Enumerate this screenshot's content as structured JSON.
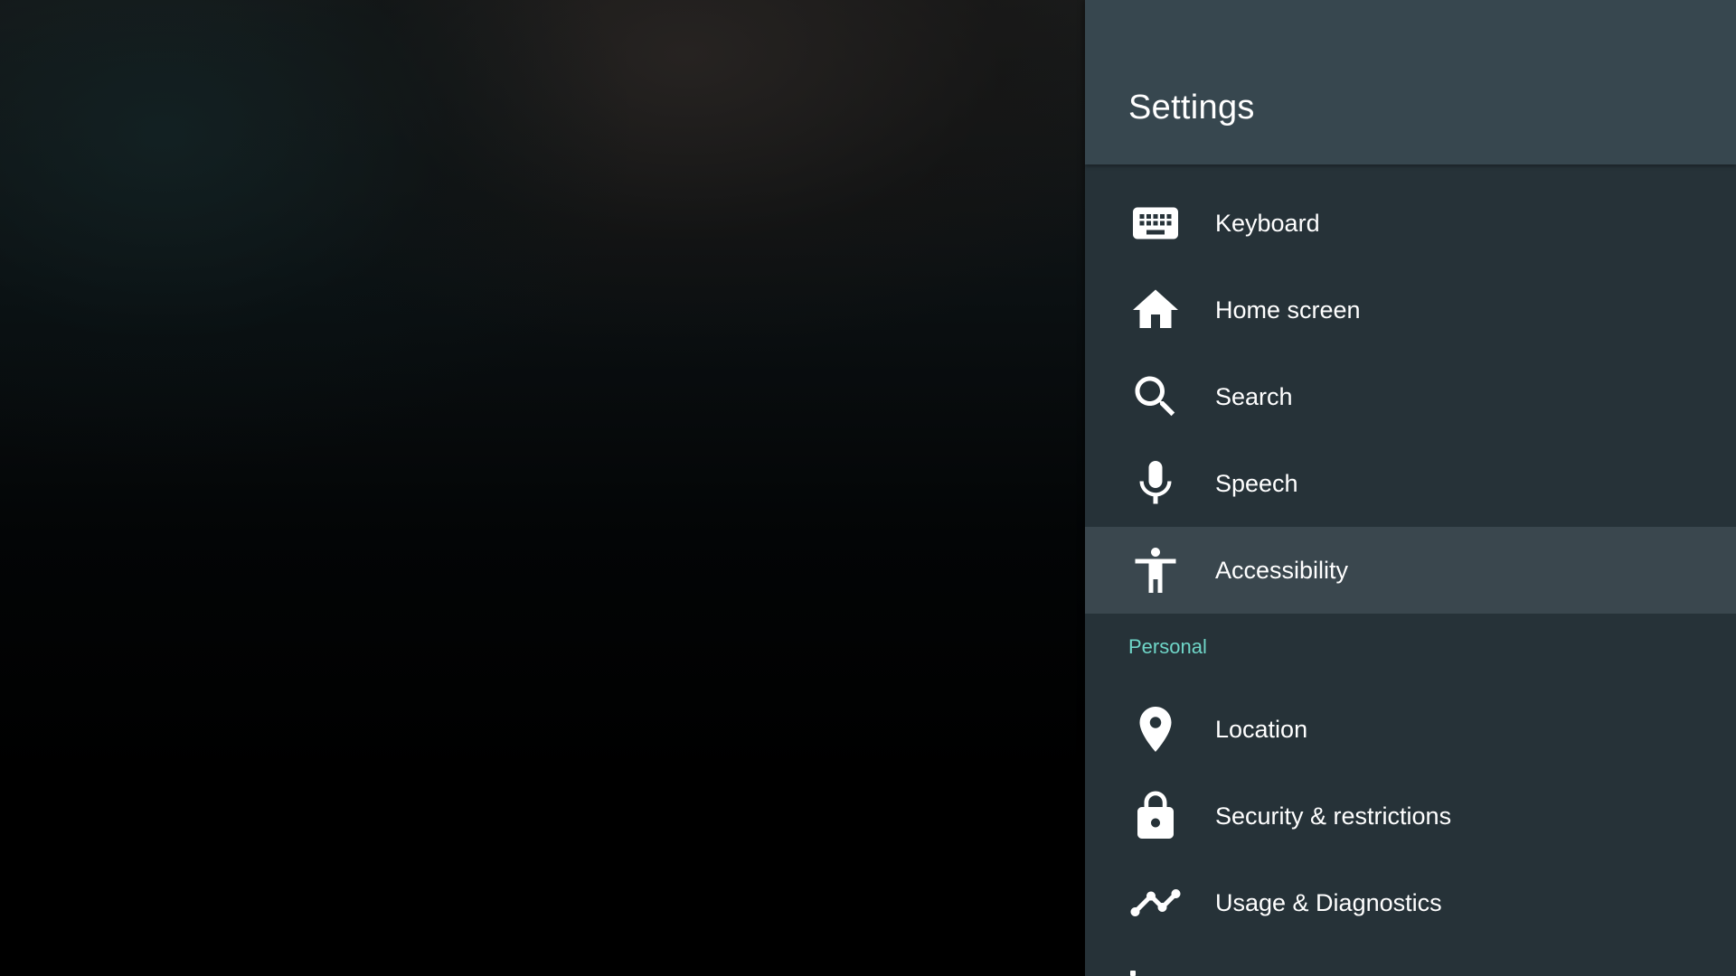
{
  "panel": {
    "title": "Settings"
  },
  "menu": {
    "device_items": [
      {
        "label": "Keyboard",
        "icon": "keyboard-icon"
      },
      {
        "label": "Home screen",
        "icon": "home-icon"
      },
      {
        "label": "Search",
        "icon": "search-icon"
      },
      {
        "label": "Speech",
        "icon": "microphone-icon"
      },
      {
        "label": "Accessibility",
        "icon": "accessibility-icon",
        "selected": true
      }
    ],
    "personal_header": "Personal",
    "personal_items": [
      {
        "label": "Location",
        "icon": "location-pin-icon"
      },
      {
        "label": "Security & restrictions",
        "icon": "lock-icon"
      },
      {
        "label": "Usage & Diagnostics",
        "icon": "trending-line-icon"
      }
    ]
  },
  "colors": {
    "panel_background": "#263238",
    "header_background": "#37474f",
    "selected_background": "#3a474e",
    "section_accent": "#6fd6c8",
    "text": "#ffffff"
  }
}
